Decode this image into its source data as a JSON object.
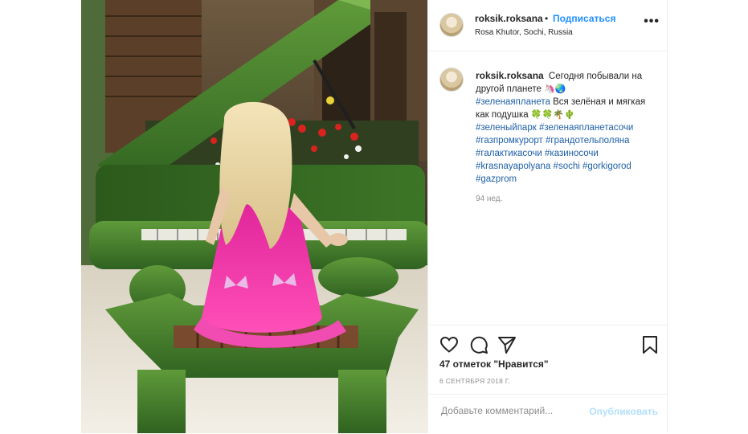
{
  "post": {
    "username": "roksik.roksana",
    "follow_separator": "•",
    "follow_label": "Подписаться",
    "location": "Rosa Khutor, Sochi, Russia",
    "more_label": "•••",
    "caption": {
      "username": "roksik.roksana",
      "text_intro": "Сегодня побывали на другой планете",
      "emoji_1": "🦄🌏",
      "hashtag_1": "#зеленаяпланета",
      "text_mid": "Вся зелёная и мягкая как подушка",
      "emoji_2": "🍀🍀🌴🌵",
      "hashtags": [
        "#зеленыйпарк",
        "#зеленаяпланетасочи",
        "#газпромкурорт",
        "#грандотельполяна",
        "#галактикасочи",
        "#казиносочи",
        "#krasnayapolyana",
        "#sochi",
        "#gorkigorod",
        "#gazprom"
      ],
      "time_ago": "94 нед."
    },
    "likes_text": "47 отметок \"Нравится\"",
    "date_text": "6 СЕНТЯБРЯ 2018 Г.",
    "comment_placeholder": "Добавьте комментарий...",
    "publish_label": "Опубликовать",
    "icons": [
      "heart-icon",
      "comment-icon",
      "share-icon",
      "bookmark-icon"
    ],
    "colors": {
      "link": "#1e90ff",
      "hashtag": "#1e5fa8",
      "muted": "#8e8e8e",
      "publish_disabled": "#b2dffc"
    }
  }
}
